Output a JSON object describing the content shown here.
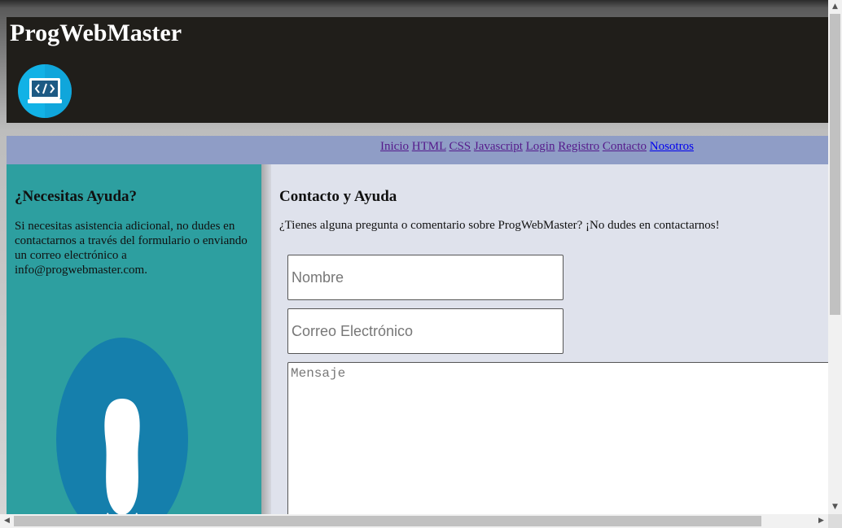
{
  "header": {
    "site_title": "ProgWebMaster",
    "logo_icon": "laptop-code-icon"
  },
  "nav": {
    "links": [
      {
        "label": "Inicio"
      },
      {
        "label": "HTML"
      },
      {
        "label": "CSS"
      },
      {
        "label": "Javascript"
      },
      {
        "label": "Login"
      },
      {
        "label": "Registro"
      },
      {
        "label": "Contacto"
      },
      {
        "label": "Nosotros"
      }
    ]
  },
  "aside": {
    "title": "¿Necesitas Ayuda?",
    "text": "Si necesitas asistencia adicional, no dudes en contactarnos a través del formulario o enviando un correo electrónico a info@progwebmaster.com.",
    "avatar_icon": "user-avatar-icon"
  },
  "main": {
    "title": "Contacto y Ayuda",
    "text": "¿Tienes alguna pregunta o comentario sobre ProgWebMaster? ¡No dudes en contactarnos!",
    "form": {
      "name_placeholder": "Nombre",
      "email_placeholder": "Correo Electrónico",
      "message_placeholder": "Mensaje"
    }
  },
  "colors": {
    "header_bg": "#201e1a",
    "nav_bg": "#8f9dc6",
    "aside_bg": "#2d9fa0",
    "main_bg": "#dfe2ec",
    "visited_link": "#551a8b",
    "link": "#0000ee"
  }
}
